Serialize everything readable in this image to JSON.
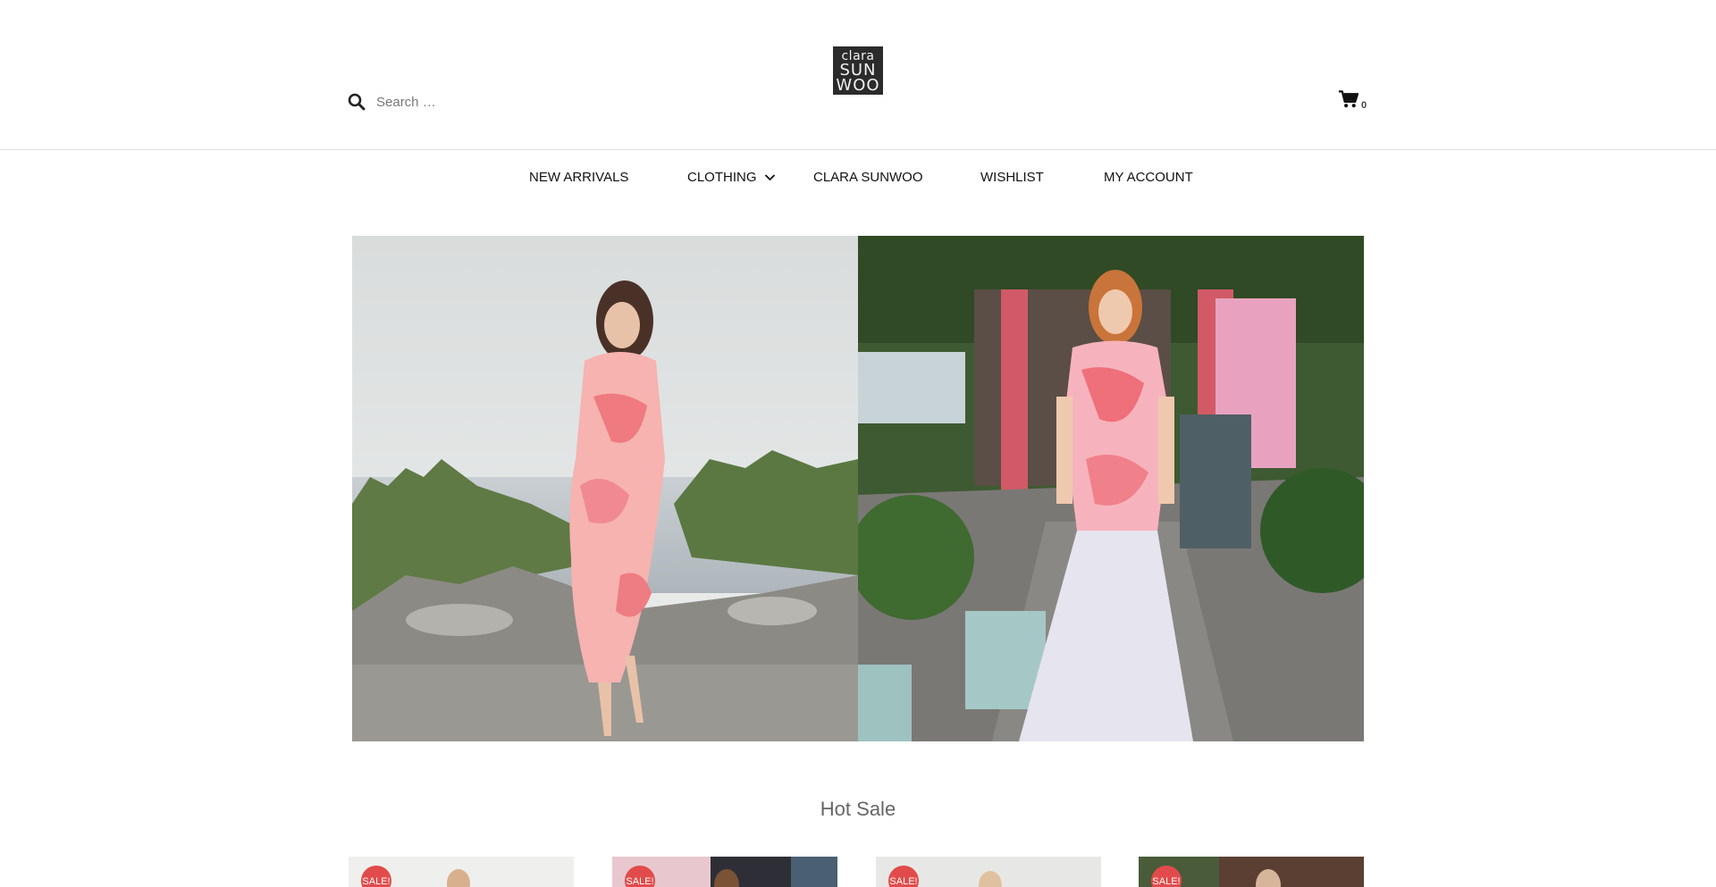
{
  "header": {
    "search": {
      "placeholder": "Search …",
      "value": ""
    },
    "logo": {
      "line1": "clara",
      "line2": "SUN",
      "line3": "WOO"
    },
    "cart": {
      "count": "0"
    }
  },
  "nav": {
    "items": [
      {
        "label": "NEW ARRIVALS"
      },
      {
        "label": "CLOTHING"
      },
      {
        "label": "CLARA SUNWOO"
      },
      {
        "label": "WISHLIST"
      },
      {
        "label": "MY ACCOUNT"
      }
    ]
  },
  "section": {
    "title": "Hot Sale"
  },
  "products": [
    {
      "badge": "SALE!"
    },
    {
      "badge": "SALE!"
    },
    {
      "badge": "SALE!"
    },
    {
      "badge": "SALE!"
    }
  ],
  "colors": {
    "sale_badge": "#e24b4b",
    "logo_bg": "#2b2b2b",
    "divider": "#e3e3e3"
  }
}
